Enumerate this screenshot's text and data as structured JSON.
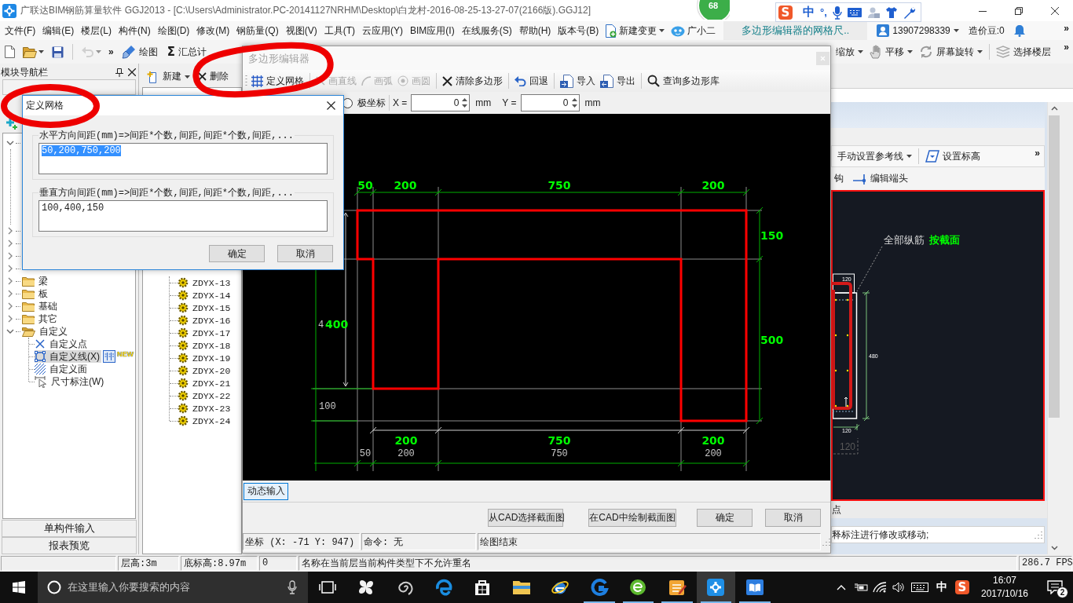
{
  "window": {
    "title": "广联达BIM钢筋算量软件 GGJ2013 - [C:\\Users\\Administrator.PC-20141127NRHM\\Desktop\\白龙村-2016-08-25-13-27-07(2166版).GGJ12]",
    "badge": "68"
  },
  "ime_bar": {
    "logo": "S",
    "mode": "中",
    "punctuation": "°,"
  },
  "menu": {
    "items": [
      "文件(F)",
      "编辑(E)",
      "楼层(L)",
      "构件(N)",
      "绘图(D)",
      "修改(M)",
      "钢筋量(Q)",
      "视图(V)",
      "工具(T)",
      "云应用(Y)",
      "BIM应用(I)",
      "在线服务(S)",
      "帮助(H)",
      "版本号(B)"
    ],
    "tools": [
      {
        "kind": "change",
        "label": "新建变更",
        "dropdown": true
      },
      {
        "kind": "assistant",
        "label": "广小二",
        "dropdown": false
      }
    ],
    "notice": "多边形编辑器的网格尺..",
    "account": "13907298339",
    "beans": "造价豆:0",
    "overflow": "»"
  },
  "toolbar": {
    "left": [
      {
        "kind": "new",
        "dropdown": false,
        "disabled": false
      },
      {
        "kind": "open",
        "dropdown": true,
        "disabled": false
      },
      {
        "kind": "save",
        "dropdown": false,
        "disabled": false
      },
      {
        "kind": "separator"
      },
      {
        "kind": "undo",
        "dropdown": true,
        "disabled": true
      },
      {
        "kind": "more",
        "label": "»"
      },
      {
        "kind": "draw",
        "label": "绘图",
        "dropdown": false,
        "disabled": false
      },
      {
        "kind": "sum",
        "icon": "Σ",
        "label": "汇总计",
        "dropdown": false,
        "disabled": false
      }
    ],
    "right": [
      {
        "kind": "zoom",
        "label": "缩放",
        "dropdown": true
      },
      {
        "kind": "pan",
        "label": "平移",
        "dropdown": true
      },
      {
        "kind": "rotate",
        "label": "屏幕旋转",
        "dropdown": true
      },
      {
        "kind": "separator"
      },
      {
        "kind": "floor",
        "label": "选择楼层",
        "dropdown": false
      }
    ],
    "overflow": "»"
  },
  "left_nav": {
    "title": "模块导航栏",
    "tree": [
      {
        "expanded": true
      },
      {
        "expanded": false
      },
      {
        "expanded": false
      },
      {
        "expanded": false
      },
      {
        "expanded": false
      },
      {
        "label": "梁",
        "expanded": false
      },
      {
        "label": "板",
        "expanded": false
      },
      {
        "label": "基础",
        "expanded": false
      },
      {
        "label": "其它",
        "expanded": false
      },
      {
        "label": "自定义",
        "expanded": true,
        "children": [
          {
            "kind": "point",
            "label": "自定义点",
            "selected": false
          },
          {
            "kind": "line",
            "label": "自定义线(X)",
            "selected": true,
            "badge": "NEW"
          },
          {
            "kind": "area",
            "label": "自定义面",
            "selected": false
          },
          {
            "kind": "dimension",
            "label": "尺寸标注(W)",
            "selected": false
          }
        ]
      }
    ],
    "buttons": [
      "单构件输入",
      "报表预览"
    ]
  },
  "components": {
    "toolbar": [
      {
        "kind": "new",
        "label": "新建",
        "dropdown": true
      },
      {
        "kind": "delete",
        "label": "删除",
        "dropdown": false
      }
    ],
    "items": [
      "ZDYX-13",
      "ZDYX-14",
      "ZDYX-15",
      "ZDYX-16",
      "ZDYX-17",
      "ZDYX-18",
      "ZDYX-19",
      "ZDYX-20",
      "ZDYX-21",
      "ZDYX-22",
      "ZDYX-23",
      "ZDYX-24"
    ]
  },
  "editor": {
    "title": "多边形编辑器",
    "toolbar": [
      {
        "kind": "grid",
        "label": "定义网格",
        "disabled": false
      },
      {
        "kind": "separator"
      },
      {
        "kind": "line",
        "label": "画直线",
        "disabled": true
      },
      {
        "kind": "arc",
        "label": "画弧",
        "disabled": true
      },
      {
        "kind": "circle",
        "label": "画圆",
        "disabled": true
      },
      {
        "kind": "separator"
      },
      {
        "kind": "clear",
        "label": "清除多边形",
        "disabled": false
      },
      {
        "kind": "separator"
      },
      {
        "kind": "undo",
        "label": "回退",
        "disabled": false
      },
      {
        "kind": "separator"
      },
      {
        "kind": "import",
        "label": "导入",
        "disabled": false
      },
      {
        "kind": "export",
        "label": "导出",
        "disabled": false
      },
      {
        "kind": "separator"
      },
      {
        "kind": "search",
        "label": "查询多边形库",
        "disabled": false
      }
    ],
    "coords": {
      "polar": {
        "label": "极坐标",
        "selected": false
      },
      "x": {
        "label": "X =",
        "value": "0",
        "unit": "mm"
      },
      "y": {
        "label": "Y =",
        "value": "0",
        "unit": "mm"
      }
    },
    "drawing": {
      "top_dimensions": [
        "50",
        "200",
        "750",
        "200"
      ],
      "right_dimensions": [
        "150",
        "500"
      ],
      "left_labels": [
        "4",
        "100"
      ],
      "left_dimension": "400",
      "bottom_labels": [
        "50",
        "200",
        "750",
        "200"
      ],
      "bottom_dimensions": [
        "200",
        "750",
        "200"
      ]
    },
    "dynamic_input": {
      "label": "动态输入",
      "on": true
    },
    "buttons": [
      "从CAD选择截面图",
      "在CAD中绘制截面图",
      "确定",
      "取消"
    ],
    "status": [
      "坐标 (X: -71 Y: 947)",
      "命令: 无",
      "绘图结束"
    ]
  },
  "dialog": {
    "title": "定义网格",
    "fields": [
      {
        "label": "水平方向间距(mm)=>间距*个数,间距,间距*个数,间距,...",
        "value": "50,200,750,200",
        "selected": true
      },
      {
        "label": "垂直方向间距(mm)=>间距*个数,间距,间距*个数,间距,...",
        "value": "100,400,150",
        "selected": false
      }
    ],
    "buttons": [
      "确定",
      "取消"
    ]
  },
  "right_panel": {
    "toolbar": [
      {
        "kind": "refline",
        "label": "手动设置参考线",
        "dropdown": true
      },
      {
        "kind": "elevation",
        "label": "设置标高",
        "dropdown": false
      }
    ],
    "overflow": "»",
    "toolbar2": [
      {
        "kind": "hook",
        "label": "钩"
      },
      {
        "kind": "edit-end",
        "label": "编辑端头"
      }
    ],
    "section": {
      "caption": "全部纵筋",
      "value": "按截面",
      "labels": [
        "120",
        "480",
        "120",
        "120"
      ]
    },
    "footer": "点",
    "message": "释标注进行修改或移动;"
  },
  "status_bar": {
    "cells": [
      "层高:3m",
      "底标高:8.97m",
      "0",
      "名称在当前层当前构件类型下不允许重名"
    ],
    "fps": "286.7 FPS"
  },
  "taskbar": {
    "search_placeholder": "在这里输入你要搜索的内容",
    "apps": [
      {
        "kind": "pinwheel",
        "running": false,
        "selected": false
      },
      {
        "kind": "spiral",
        "running": false,
        "selected": false
      },
      {
        "kind": "edge",
        "running": false,
        "selected": false
      },
      {
        "kind": "store",
        "running": false,
        "selected": false
      },
      {
        "kind": "folder",
        "running": false,
        "selected": false
      },
      {
        "kind": "ie",
        "running": false,
        "selected": false
      },
      {
        "kind": "swirl",
        "running": true,
        "selected": false
      },
      {
        "kind": "globe",
        "running": true,
        "selected": false
      },
      {
        "kind": "notepad",
        "running": true,
        "selected": false
      },
      {
        "kind": "cross",
        "running": true,
        "selected": true
      },
      {
        "kind": "book",
        "running": true,
        "selected": false
      }
    ],
    "tray": {
      "ime": "中",
      "ime_logo": "S",
      "time": "16:07",
      "date": "2017/10/16",
      "notifications": "2"
    }
  }
}
